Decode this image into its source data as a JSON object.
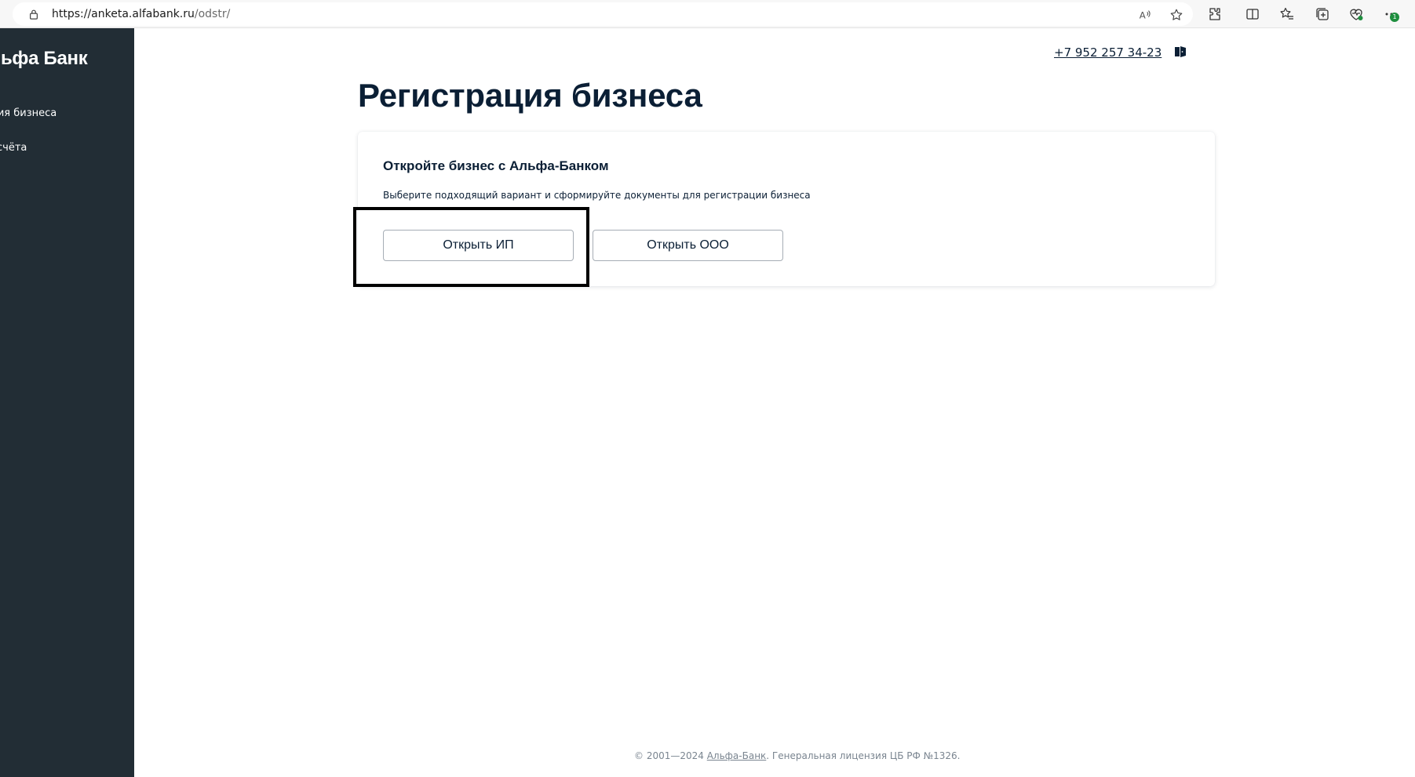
{
  "browser": {
    "url_host": "https://anketa.alfabank.ru",
    "url_path": "/odstr/",
    "badge_count": "1"
  },
  "sidebar": {
    "logo": "льфа Банк",
    "items": [
      {
        "label": "ция бизнеса"
      },
      {
        "label": "счёта"
      }
    ]
  },
  "header": {
    "phone": "+7 952 257 34-23"
  },
  "main": {
    "title": "Регистрация бизнеса",
    "card": {
      "title": "Откройте бизнес с Альфа-Банком",
      "subtitle": "Выберите подходящий вариант и сформируйте документы для регистрации бизнеса",
      "buttons": [
        {
          "label": "Открыть ИП"
        },
        {
          "label": "Открыть ООО"
        }
      ]
    }
  },
  "footer": {
    "prefix": "© 2001—2024 ",
    "link": "Альфа-Банк",
    "suffix": ". Генеральная лицензия ЦБ РФ №1326."
  },
  "colors": {
    "sidebar_bg": "#222d35",
    "text_primary": "#0b1f35",
    "button_border": "#a6adb5",
    "focus_frame": "#000000"
  },
  "icons": [
    "lock-icon",
    "read-aloud-icon",
    "favorite-star-icon",
    "extensions-icon",
    "split-screen-icon",
    "favorites-icon",
    "collections-icon",
    "browser-essentials-icon",
    "more-icon",
    "exit-icon"
  ]
}
